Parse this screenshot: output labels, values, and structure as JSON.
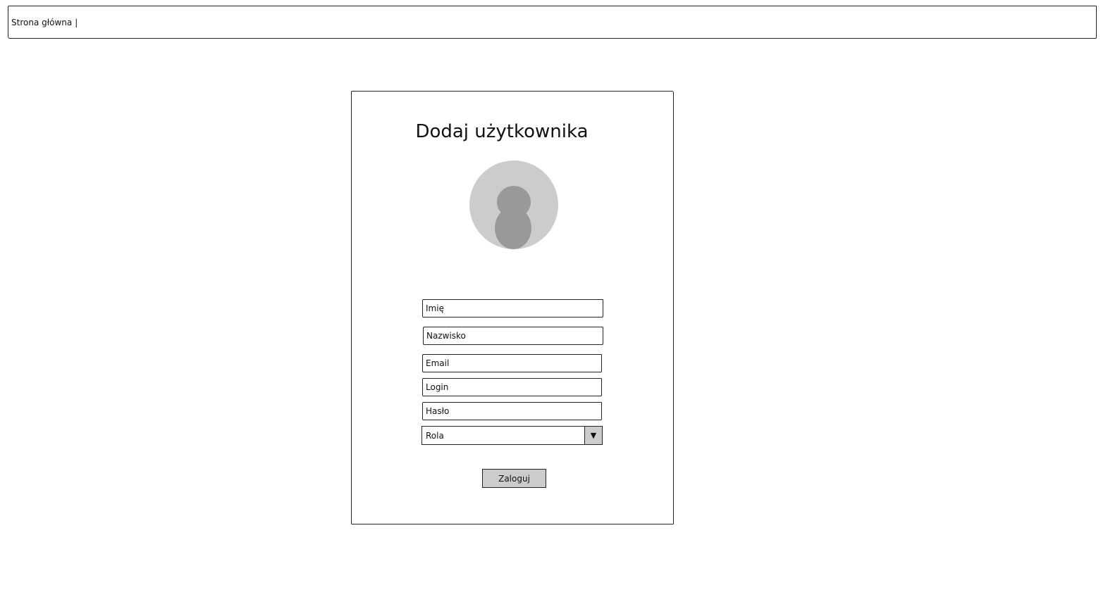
{
  "header": {
    "home_link": "Strona główna",
    "separator": "|"
  },
  "form": {
    "title": "Dodaj użytkownika",
    "avatar_icon": "user-placeholder-icon",
    "fields": {
      "first_name": {
        "placeholder": "Imię",
        "value": ""
      },
      "last_name": {
        "placeholder": "Nazwisko",
        "value": ""
      },
      "email": {
        "placeholder": "Email",
        "value": ""
      },
      "login": {
        "placeholder": "Login",
        "value": ""
      },
      "password": {
        "placeholder": "Hasło",
        "value": ""
      }
    },
    "role_select": {
      "selected": "Rola",
      "arrow_icon": "chevron-down-icon"
    },
    "submit_label": "Zaloguj"
  },
  "colors": {
    "border": "#222222",
    "placeholder_gray": "#cccccc",
    "avatar_figure": "#999999",
    "background": "#ffffff"
  }
}
